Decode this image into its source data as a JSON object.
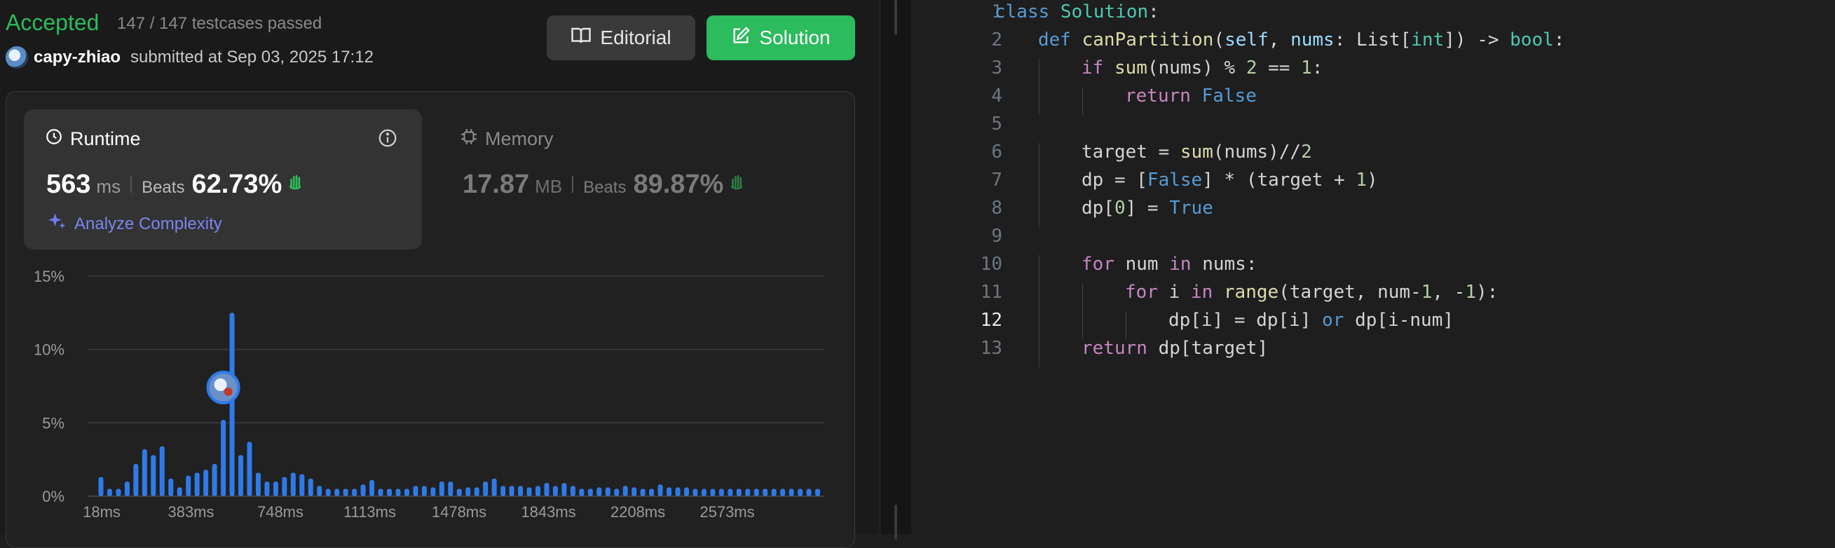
{
  "submission": {
    "status": "Accepted",
    "testcases": "147 / 147 testcases passed",
    "username": "capy-zhiao",
    "submitted": "submitted at Sep 03, 2025 17:12"
  },
  "buttons": {
    "editorial": "Editorial",
    "solution": "Solution"
  },
  "runtime": {
    "title": "Runtime",
    "value": "563",
    "unit": "ms",
    "beats_label": "Beats",
    "beats": "62.73%",
    "analyze": "Analyze Complexity"
  },
  "memory": {
    "title": "Memory",
    "value": "17.87",
    "unit": "MB",
    "beats_label": "Beats",
    "beats": "89.87%"
  },
  "colors": {
    "accepted": "#2cbb5d",
    "bar": "#2f7ae8",
    "code_bg": "#1e1e1e"
  },
  "chart_data": {
    "type": "bar",
    "y_ticks": [
      "15%",
      "10%",
      "5%",
      "0%"
    ],
    "x_ticks": [
      "18ms",
      "383ms",
      "748ms",
      "1113ms",
      "1478ms",
      "1843ms",
      "2208ms",
      "2573ms"
    ],
    "ylim": [
      0,
      15
    ],
    "marker_index": 14,
    "values": [
      1.3,
      0.5,
      0.5,
      1.0,
      2.2,
      3.2,
      2.8,
      3.4,
      1.2,
      0.6,
      1.4,
      1.6,
      1.8,
      2.2,
      5.2,
      12.5,
      2.8,
      3.7,
      1.6,
      1.0,
      1.0,
      1.3,
      1.6,
      1.5,
      1.2,
      0.7,
      0.5,
      0.5,
      0.5,
      0.5,
      0.8,
      1.1,
      0.5,
      0.5,
      0.5,
      0.5,
      0.7,
      0.7,
      0.6,
      1.0,
      1.0,
      0.5,
      0.6,
      0.6,
      1.0,
      1.2,
      0.7,
      0.7,
      0.7,
      0.6,
      0.7,
      0.9,
      0.7,
      0.9,
      0.7,
      0.5,
      0.5,
      0.6,
      0.6,
      0.5,
      0.7,
      0.6,
      0.5,
      0.5,
      0.8,
      0.6,
      0.6,
      0.6,
      0.5,
      0.5,
      0.5,
      0.5,
      0.5,
      0.5,
      0.5,
      0.5,
      0.5,
      0.5,
      0.5,
      0.5,
      0.5,
      0.5,
      0.5
    ]
  },
  "code": {
    "active_line": 12,
    "lines": [
      [
        [
          "kb",
          "class "
        ],
        [
          "cls",
          "Solution"
        ],
        [
          "tx",
          ":"
        ]
      ],
      [
        [
          "kb",
          "def "
        ],
        [
          "fn",
          "canPartition"
        ],
        [
          "tx",
          "("
        ],
        [
          "pm",
          "self"
        ],
        [
          "tx",
          ", "
        ],
        [
          "pm",
          "nums"
        ],
        [
          "tx",
          ": List["
        ],
        [
          "cls",
          "int"
        ],
        [
          "tx",
          "]) -> "
        ],
        [
          "cls",
          "bool"
        ],
        [
          "tx",
          ":"
        ]
      ],
      [
        [
          "kw",
          "if "
        ],
        [
          "fn",
          "sum"
        ],
        [
          "tx",
          "(nums) % "
        ],
        [
          "nm",
          "2"
        ],
        [
          "tx",
          " == "
        ],
        [
          "nm",
          "1"
        ],
        [
          "tx",
          ":"
        ]
      ],
      [
        [
          "kw",
          "return "
        ],
        [
          "kb",
          "False"
        ]
      ],
      [],
      [
        [
          "tx",
          "target = "
        ],
        [
          "fn",
          "sum"
        ],
        [
          "tx",
          "(nums)//"
        ],
        [
          "nm",
          "2"
        ]
      ],
      [
        [
          "tx",
          "dp = ["
        ],
        [
          "kb",
          "False"
        ],
        [
          "tx",
          "] * (target + "
        ],
        [
          "nm",
          "1"
        ],
        [
          "tx",
          ")"
        ]
      ],
      [
        [
          "tx",
          "dp["
        ],
        [
          "nm",
          "0"
        ],
        [
          "tx",
          "] = "
        ],
        [
          "kb",
          "True"
        ]
      ],
      [],
      [
        [
          "kw",
          "for "
        ],
        [
          "tx",
          "num "
        ],
        [
          "kw",
          "in "
        ],
        [
          "tx",
          "nums:"
        ]
      ],
      [
        [
          "kw",
          "for "
        ],
        [
          "tx",
          "i "
        ],
        [
          "kw",
          "in "
        ],
        [
          "fn",
          "range"
        ],
        [
          "tx",
          "(target, num-"
        ],
        [
          "nm",
          "1"
        ],
        [
          "tx",
          ", -"
        ],
        [
          "nm",
          "1"
        ],
        [
          "tx",
          "):"
        ]
      ],
      [
        [
          "tx",
          "dp[i] = dp[i] "
        ],
        [
          "kb",
          "or "
        ],
        [
          "tx",
          "dp[i-num]"
        ]
      ],
      [
        [
          "kw",
          "return "
        ],
        [
          "tx",
          "dp[target]"
        ]
      ]
    ],
    "indents": [
      0,
      1,
      2,
      3,
      0,
      2,
      2,
      2,
      0,
      2,
      3,
      4,
      2
    ]
  }
}
